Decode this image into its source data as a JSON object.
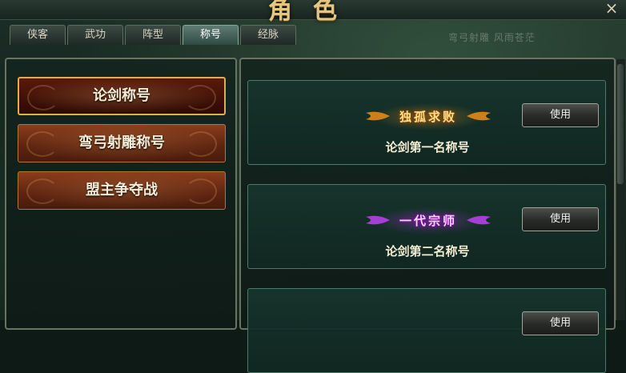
{
  "window": {
    "title": "角色",
    "close_glyph": "×",
    "background_text": "弯弓射雕 风雨苍茫"
  },
  "tabs": [
    {
      "label": "侠客",
      "active": false
    },
    {
      "label": "武功",
      "active": false
    },
    {
      "label": "阵型",
      "active": false
    },
    {
      "label": "称号",
      "active": true
    },
    {
      "label": "经脉",
      "active": false
    }
  ],
  "categories": [
    {
      "label": "论剑称号",
      "selected": true
    },
    {
      "label": "弯弓射雕称号",
      "selected": false
    },
    {
      "label": "盟主争夺战",
      "selected": false
    }
  ],
  "titles": [
    {
      "badge": "独孤求败",
      "badge_color": "#ffb030",
      "name": "论剑第一名称号",
      "action_label": "使用"
    },
    {
      "badge": "一代宗师",
      "badge_color": "#c040ff",
      "name": "论剑第二名称号",
      "action_label": "使用"
    },
    {
      "badge": "",
      "badge_color": "",
      "name": "",
      "action_label": "使用"
    }
  ],
  "colors": {
    "accent_gold": "#e3c781",
    "panel_border": "#6a7360",
    "card_border": "#4a7a6a"
  }
}
